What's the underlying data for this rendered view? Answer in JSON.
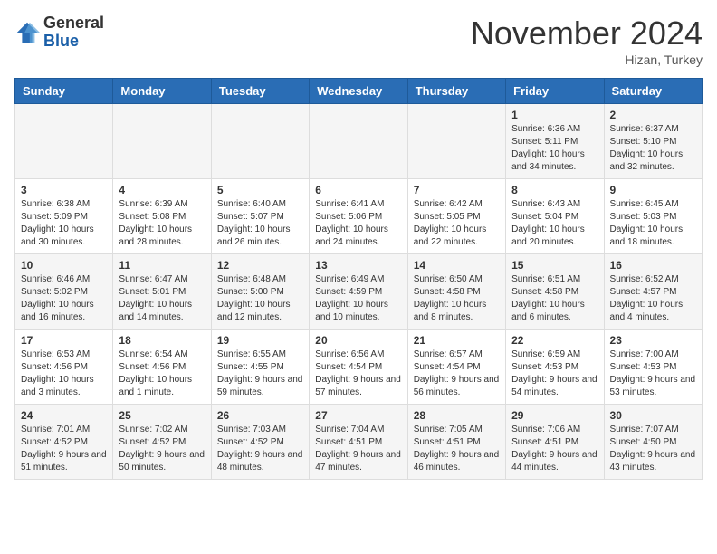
{
  "header": {
    "logo_general": "General",
    "logo_blue": "Blue",
    "month_title": "November 2024",
    "location": "Hizan, Turkey"
  },
  "weekdays": [
    "Sunday",
    "Monday",
    "Tuesday",
    "Wednesday",
    "Thursday",
    "Friday",
    "Saturday"
  ],
  "weeks": [
    [
      {
        "day": "",
        "info": ""
      },
      {
        "day": "",
        "info": ""
      },
      {
        "day": "",
        "info": ""
      },
      {
        "day": "",
        "info": ""
      },
      {
        "day": "",
        "info": ""
      },
      {
        "day": "1",
        "info": "Sunrise: 6:36 AM\nSunset: 5:11 PM\nDaylight: 10 hours and 34 minutes."
      },
      {
        "day": "2",
        "info": "Sunrise: 6:37 AM\nSunset: 5:10 PM\nDaylight: 10 hours and 32 minutes."
      }
    ],
    [
      {
        "day": "3",
        "info": "Sunrise: 6:38 AM\nSunset: 5:09 PM\nDaylight: 10 hours and 30 minutes."
      },
      {
        "day": "4",
        "info": "Sunrise: 6:39 AM\nSunset: 5:08 PM\nDaylight: 10 hours and 28 minutes."
      },
      {
        "day": "5",
        "info": "Sunrise: 6:40 AM\nSunset: 5:07 PM\nDaylight: 10 hours and 26 minutes."
      },
      {
        "day": "6",
        "info": "Sunrise: 6:41 AM\nSunset: 5:06 PM\nDaylight: 10 hours and 24 minutes."
      },
      {
        "day": "7",
        "info": "Sunrise: 6:42 AM\nSunset: 5:05 PM\nDaylight: 10 hours and 22 minutes."
      },
      {
        "day": "8",
        "info": "Sunrise: 6:43 AM\nSunset: 5:04 PM\nDaylight: 10 hours and 20 minutes."
      },
      {
        "day": "9",
        "info": "Sunrise: 6:45 AM\nSunset: 5:03 PM\nDaylight: 10 hours and 18 minutes."
      }
    ],
    [
      {
        "day": "10",
        "info": "Sunrise: 6:46 AM\nSunset: 5:02 PM\nDaylight: 10 hours and 16 minutes."
      },
      {
        "day": "11",
        "info": "Sunrise: 6:47 AM\nSunset: 5:01 PM\nDaylight: 10 hours and 14 minutes."
      },
      {
        "day": "12",
        "info": "Sunrise: 6:48 AM\nSunset: 5:00 PM\nDaylight: 10 hours and 12 minutes."
      },
      {
        "day": "13",
        "info": "Sunrise: 6:49 AM\nSunset: 4:59 PM\nDaylight: 10 hours and 10 minutes."
      },
      {
        "day": "14",
        "info": "Sunrise: 6:50 AM\nSunset: 4:58 PM\nDaylight: 10 hours and 8 minutes."
      },
      {
        "day": "15",
        "info": "Sunrise: 6:51 AM\nSunset: 4:58 PM\nDaylight: 10 hours and 6 minutes."
      },
      {
        "day": "16",
        "info": "Sunrise: 6:52 AM\nSunset: 4:57 PM\nDaylight: 10 hours and 4 minutes."
      }
    ],
    [
      {
        "day": "17",
        "info": "Sunrise: 6:53 AM\nSunset: 4:56 PM\nDaylight: 10 hours and 3 minutes."
      },
      {
        "day": "18",
        "info": "Sunrise: 6:54 AM\nSunset: 4:56 PM\nDaylight: 10 hours and 1 minute."
      },
      {
        "day": "19",
        "info": "Sunrise: 6:55 AM\nSunset: 4:55 PM\nDaylight: 9 hours and 59 minutes."
      },
      {
        "day": "20",
        "info": "Sunrise: 6:56 AM\nSunset: 4:54 PM\nDaylight: 9 hours and 57 minutes."
      },
      {
        "day": "21",
        "info": "Sunrise: 6:57 AM\nSunset: 4:54 PM\nDaylight: 9 hours and 56 minutes."
      },
      {
        "day": "22",
        "info": "Sunrise: 6:59 AM\nSunset: 4:53 PM\nDaylight: 9 hours and 54 minutes."
      },
      {
        "day": "23",
        "info": "Sunrise: 7:00 AM\nSunset: 4:53 PM\nDaylight: 9 hours and 53 minutes."
      }
    ],
    [
      {
        "day": "24",
        "info": "Sunrise: 7:01 AM\nSunset: 4:52 PM\nDaylight: 9 hours and 51 minutes."
      },
      {
        "day": "25",
        "info": "Sunrise: 7:02 AM\nSunset: 4:52 PM\nDaylight: 9 hours and 50 minutes."
      },
      {
        "day": "26",
        "info": "Sunrise: 7:03 AM\nSunset: 4:52 PM\nDaylight: 9 hours and 48 minutes."
      },
      {
        "day": "27",
        "info": "Sunrise: 7:04 AM\nSunset: 4:51 PM\nDaylight: 9 hours and 47 minutes."
      },
      {
        "day": "28",
        "info": "Sunrise: 7:05 AM\nSunset: 4:51 PM\nDaylight: 9 hours and 46 minutes."
      },
      {
        "day": "29",
        "info": "Sunrise: 7:06 AM\nSunset: 4:51 PM\nDaylight: 9 hours and 44 minutes."
      },
      {
        "day": "30",
        "info": "Sunrise: 7:07 AM\nSunset: 4:50 PM\nDaylight: 9 hours and 43 minutes."
      }
    ]
  ]
}
